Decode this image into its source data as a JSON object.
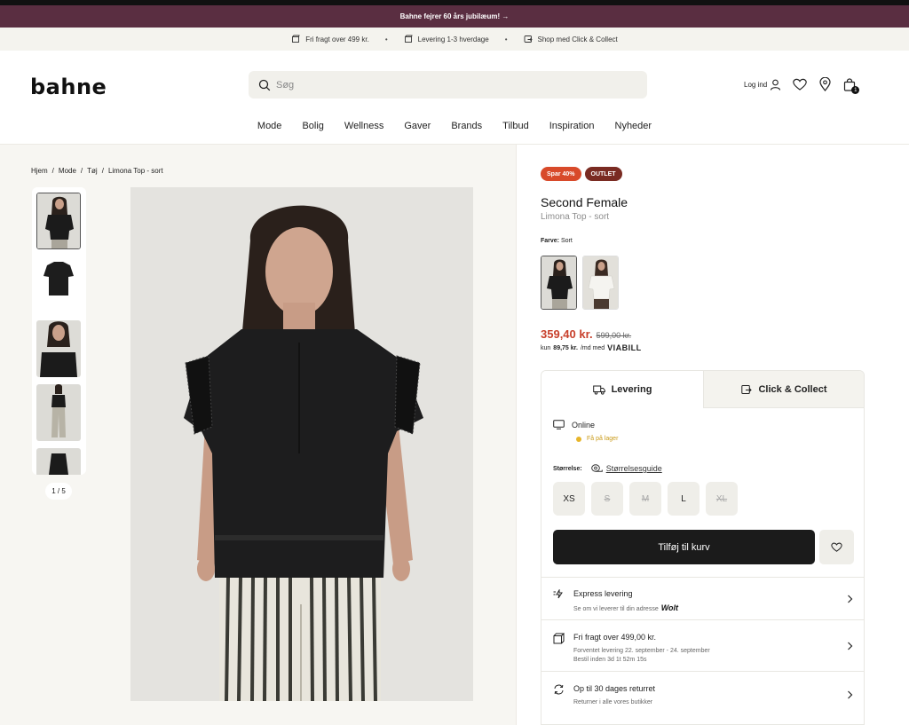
{
  "promo": {
    "text": "Bahne fejrer 60 års jubilæum! →"
  },
  "usp": [
    {
      "icon": "box-icon",
      "label": "Fri fragt over 499 kr."
    },
    {
      "icon": "package-icon",
      "label": "Levering 1-3 hverdage"
    },
    {
      "icon": "store-icon",
      "label": "Shop med Click & Collect"
    }
  ],
  "header": {
    "logo": "bahne",
    "search_placeholder": "Søg",
    "login_label": "Log ind",
    "cart_count": "1"
  },
  "nav": [
    "Mode",
    "Bolig",
    "Wellness",
    "Gaver",
    "Brands",
    "Tilbud",
    "Inspiration",
    "Nyheder"
  ],
  "breadcrumb": [
    "Hjem",
    "Mode",
    "Tøj",
    "Limona Top - sort"
  ],
  "gallery": {
    "counter": "1 / 5"
  },
  "product": {
    "badge_sale": "Spar 40%",
    "badge_outlet": "OUTLET",
    "brand": "Second Female",
    "name": "Limona Top - sort",
    "color_label": "Farve:",
    "color_value": "Sort",
    "price_now": "359,40 kr.",
    "price_old": "599,00 kr.",
    "installment_prefix": "kun",
    "installment_amount": "89,75 kr.",
    "installment_suffix": "/md med",
    "installment_provider": "VIABILL"
  },
  "delivery": {
    "tab_delivery": "Levering",
    "tab_collect": "Click & Collect",
    "online_label": "Online",
    "stock_label": "Få på lager",
    "size_label": "Størrelse:",
    "size_guide": "Størrelsesguide",
    "sizes": [
      {
        "label": "XS",
        "available": true
      },
      {
        "label": "S",
        "available": false
      },
      {
        "label": "M",
        "available": false
      },
      {
        "label": "L",
        "available": true
      },
      {
        "label": "XL",
        "available": false
      }
    ],
    "add_to_cart": "Tilføj til kurv"
  },
  "info_rows": [
    {
      "title": "Express levering",
      "sub1": "Se om vi leverer til din adresse",
      "sub1_brand": "Wolt"
    },
    {
      "title": "Fri fragt over 499,00 kr.",
      "sub1": "Forventet levering 22. september - 24. september",
      "sub2": "Bestil inden 3d 1t 52m 15s"
    },
    {
      "title": "Op til 30 dages returret",
      "sub1": "Returner i alle vores butikker"
    }
  ],
  "colors": {
    "promo_bg": "#5a2e41",
    "sale_badge": "#d84a2a",
    "outlet_badge": "#7a2b22",
    "price": "#c8402c",
    "stock": "#e7b52a"
  }
}
